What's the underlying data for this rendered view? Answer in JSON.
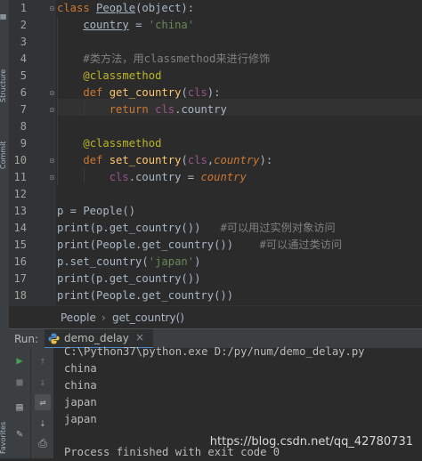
{
  "editor": {
    "line_numbers": [
      "1",
      "2",
      "3",
      "4",
      "5",
      "6",
      "7",
      "8",
      "9",
      "10",
      "11",
      "12",
      "13",
      "14",
      "15",
      "16",
      "17",
      "18"
    ],
    "line1": {
      "kw": "class",
      "space": " ",
      "cname": "People",
      "rest": "(object):"
    },
    "line2": {
      "indent": "    ",
      "id": "country",
      "op": " = ",
      "str": "'china'"
    },
    "line4": {
      "indent": "    ",
      "comment": "#类方法，用classmethod来进行修饰"
    },
    "line5": {
      "indent": "    ",
      "decorator": "@classmethod"
    },
    "line6": {
      "indent": "    ",
      "kw": "def",
      "space": " ",
      "fn": "get_country",
      "open": "(",
      "param": "cls",
      "close": "):"
    },
    "line7": {
      "indent": "        ",
      "kw": "return",
      "space": " ",
      "self": "cls",
      "dot": ".",
      "attr": "country"
    },
    "line9": {
      "indent": "    ",
      "decorator": "@classmethod"
    },
    "line10": {
      "indent": "    ",
      "kw": "def",
      "space": " ",
      "fn": "set_country",
      "open": "(",
      "param": "cls",
      "comma": ",",
      "param2": "country",
      "close": "):"
    },
    "line11": {
      "indent": "        ",
      "self": "cls",
      "dot": ".",
      "attr": "country",
      "op": " = ",
      "val": "country"
    },
    "line13": {
      "text": "p = People()"
    },
    "line14": {
      "code": "print(p.get_country())",
      "pad": "   ",
      "comment": "#可以用过实例对象访问"
    },
    "line15": {
      "code": "print(People.get_country())",
      "pad": "    ",
      "comment": "#可以通过类访问"
    },
    "line16": {
      "pre": "p.set_country(",
      "str": "'japan'",
      "post": ")"
    },
    "line17": {
      "code": "print(p.get_country())"
    },
    "line18": {
      "code": "print(People.get_country())"
    }
  },
  "breadcrumb": {
    "class": "People",
    "sep": "›",
    "method": "get_country()"
  },
  "run_panel": {
    "run_label": "Run:",
    "tab_label": "demo_delay",
    "tab_close": "×",
    "command": "C:\\Python37\\python.exe D:/py/num/demo_delay.py",
    "output": [
      "china",
      "china",
      "japan",
      "japan"
    ],
    "exit_message": "Process finished with exit code 0"
  },
  "side_tabs": {
    "structure": "Structure",
    "commit": "Commit",
    "favorites": "Favorites"
  },
  "watermark": "https://blog.csdn.net/qq_42780731",
  "colors": {
    "keyword": "#cc7832",
    "string": "#6a8759",
    "comment": "#808080",
    "decorator": "#bbb529",
    "self": "#94558d",
    "function": "#ffc66d",
    "background": "#2b2b2b"
  },
  "icons": {
    "run": "play-icon",
    "stop": "stop-icon",
    "up": "arrow-up-icon",
    "down": "arrow-down-icon",
    "layout": "layout-icon",
    "soft_wrap": "soft-wrap-icon",
    "pin": "pin-icon",
    "print": "print-icon",
    "python": "python-icon"
  }
}
